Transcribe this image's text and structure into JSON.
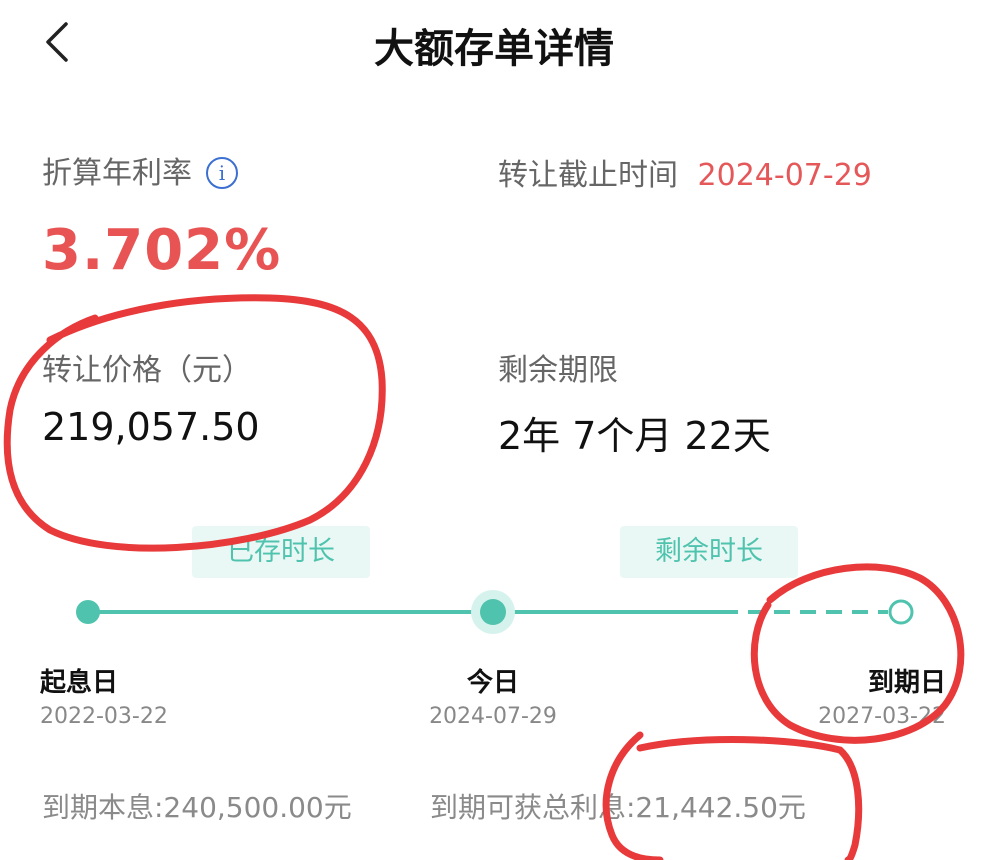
{
  "header": {
    "title": "大额存单详情",
    "back_icon": "chevron-left-icon"
  },
  "rate": {
    "label": "折算年利率",
    "info_icon": "info-icon",
    "value": "3.702%"
  },
  "transfer_deadline": {
    "label": "转让截止时间",
    "value": "2024-07-29"
  },
  "transfer_price": {
    "label": "转让价格（元）",
    "value": "219,057.50"
  },
  "remaining_term": {
    "label": "剩余期限",
    "value": "2年 7个月 22天"
  },
  "timeline": {
    "elapsed_label": "已存时长",
    "remaining_label": "剩余时长",
    "progress": 0.5,
    "nodes": [
      {
        "label": "起息日",
        "date": "2022-03-22"
      },
      {
        "label": "今日",
        "date": "2024-07-29"
      },
      {
        "label": "到期日",
        "date": "2027-03-22"
      }
    ]
  },
  "footer": {
    "maturity_total": "到期本息:240,500.00元",
    "total_interest": "到期可获总利息:21,442.50元"
  },
  "colors": {
    "accent_teal": "#4fc3ad",
    "highlight_red": "#e85454",
    "annotation_red": "#e83a3a"
  }
}
